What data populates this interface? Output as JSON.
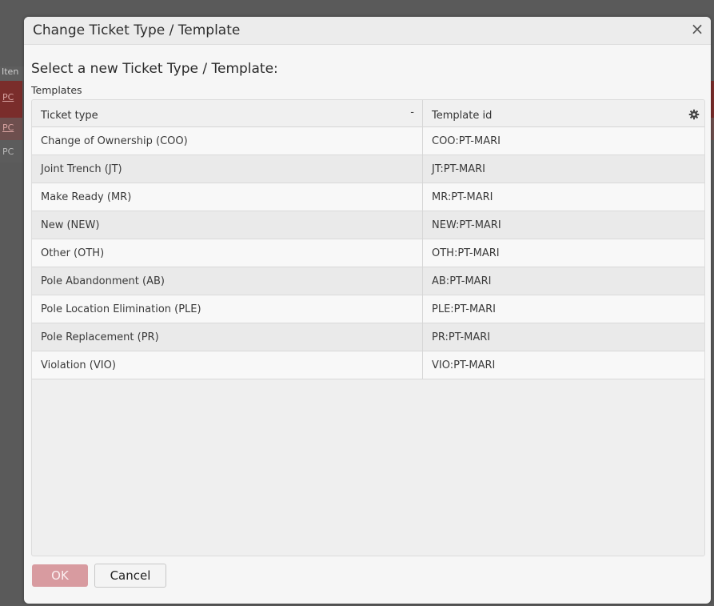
{
  "background": {
    "header_fragment": "Iten",
    "link_fragments": [
      "PC",
      "PC",
      "PC"
    ]
  },
  "dialog": {
    "title": "Change Ticket Type / Template",
    "close_glyph": "×",
    "prompt": "Select a new Ticket Type / Template:",
    "section_label": "Templates",
    "grid": {
      "columns": [
        {
          "label": "Ticket type",
          "sort_glyph": "-"
        },
        {
          "label": "Template id",
          "icon": "gear-icon"
        }
      ],
      "rows": [
        {
          "ticket_type": "Change of Ownership (COO)",
          "template_id": "COO:PT-MARI"
        },
        {
          "ticket_type": "Joint Trench (JT)",
          "template_id": "JT:PT-MARI"
        },
        {
          "ticket_type": "Make Ready (MR)",
          "template_id": "MR:PT-MARI"
        },
        {
          "ticket_type": "New (NEW)",
          "template_id": "NEW:PT-MARI"
        },
        {
          "ticket_type": "Other (OTH)",
          "template_id": "OTH:PT-MARI"
        },
        {
          "ticket_type": "Pole Abandonment (AB)",
          "template_id": "AB:PT-MARI"
        },
        {
          "ticket_type": "Pole Location Elimination (PLE)",
          "template_id": "PLE:PT-MARI"
        },
        {
          "ticket_type": "Pole Replacement (PR)",
          "template_id": "PR:PT-MARI"
        },
        {
          "ticket_type": "Violation (VIO)",
          "template_id": "VIO:PT-MARI"
        }
      ]
    },
    "buttons": {
      "ok_label": "OK",
      "cancel_label": "Cancel"
    },
    "colors": {
      "ok_button": "#d89ba0",
      "backdrop": "#5a5a5a"
    }
  }
}
